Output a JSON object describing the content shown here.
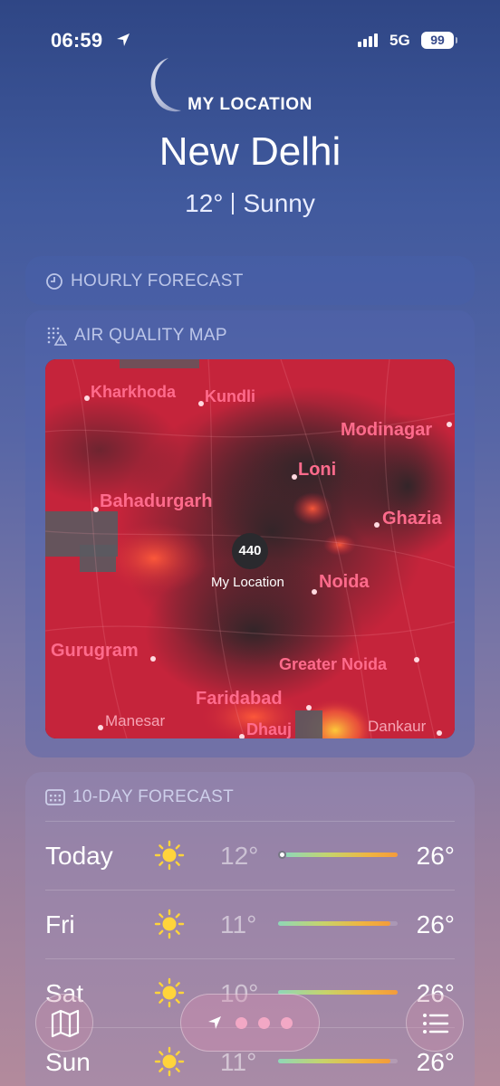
{
  "status_bar": {
    "time": "06:59",
    "network": "5G",
    "battery": "99",
    "icons": [
      "location-arrow-icon",
      "signal-icon",
      "battery-icon"
    ]
  },
  "header": {
    "subtitle": "MY LOCATION",
    "city": "New Delhi",
    "temperature": "12°",
    "condition": "Sunny",
    "icon": "moon-icon"
  },
  "hourly": {
    "title": "HOURLY FORECAST",
    "icon": "clock-icon"
  },
  "air_quality": {
    "title": "AIR QUALITY MAP",
    "icon": "air-quality-icon",
    "aqi_value": "440",
    "my_location_label": "My Location",
    "places": [
      {
        "name": "Kharkhoda"
      },
      {
        "name": "Kundli"
      },
      {
        "name": "Modinagar"
      },
      {
        "name": "Loni"
      },
      {
        "name": "Bahadurgarh"
      },
      {
        "name": "Ghazia"
      },
      {
        "name": "Noida"
      },
      {
        "name": "Gurugram"
      },
      {
        "name": "Greater Noida"
      },
      {
        "name": "Faridabad"
      },
      {
        "name": "Manesar"
      },
      {
        "name": "Dhauj"
      },
      {
        "name": "Dankaur"
      }
    ]
  },
  "ten_day": {
    "title": "10-DAY FORECAST",
    "icon": "calendar-icon",
    "days": [
      {
        "day": "Today",
        "low": "12°",
        "high": "26°",
        "icon": "sun-icon",
        "current_position": 0.0
      },
      {
        "day": "Fri",
        "low": "11°",
        "high": "26°",
        "icon": "sun-icon"
      },
      {
        "day": "Sat",
        "low": "10°",
        "high": "26°",
        "icon": "sun-icon"
      },
      {
        "day": "Sun",
        "low": "11°",
        "high": "26°",
        "icon": "sun-icon"
      }
    ]
  },
  "tab_bar": {
    "left_icon": "map-icon",
    "right_icon": "list-icon",
    "pager_icon": "location-arrow-icon",
    "page_count": 3
  },
  "colors": {
    "aqi_high": "#c8243c",
    "place_label": "#ff6b8c"
  }
}
